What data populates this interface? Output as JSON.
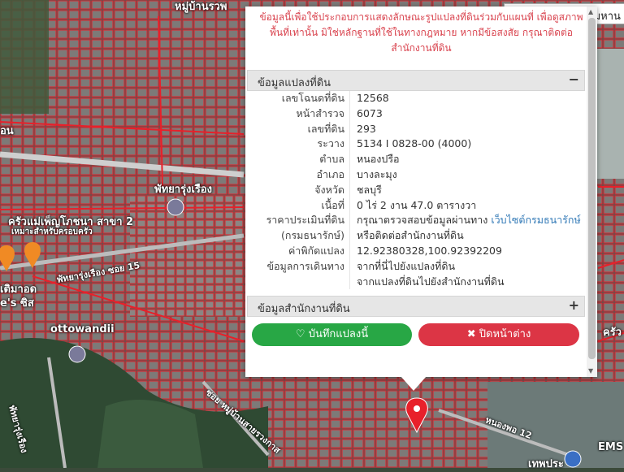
{
  "colors": {
    "parcel_line": "#e8202a",
    "save_button": "#28a745",
    "close_button": "#dc3545",
    "notice_text": "#d9434e",
    "link": "#337ab7"
  },
  "map": {
    "labels": {
      "top_center": "หมู่บ้านรวพ",
      "left_edge": "อน",
      "road_pattaya": "พัทยารุ่งเรือง",
      "restaurant": "ครัวแม่เพ็ญโภชนา สาขา 2",
      "restaurant_sub": "เหมาะสำหรับครอบครัว",
      "soi15": "พัทยารุ่งเรือง ซอย 15",
      "left_mid": "เติมาอด",
      "left_mid2": "e's ซิส",
      "ottowandii": "ottowandii",
      "road_left_vertical": "พัทยารุ่งเรือง",
      "soi_village": "ซอย หมู่บ้านสายรวงกาส",
      "nong_ponghu": "หนองพอ 12",
      "right_kitchen": "ครัว",
      "ems": "EMS",
      "thep": "เทพประ"
    }
  },
  "search": {
    "value": "เขต สาทร กรุงเทพมหาน"
  },
  "popup": {
    "notice": "ข้อมูลนี้เพื่อใช้ประกอบการแสดงลักษณะรูปแปลงที่ดินร่วมกับแผนที่ เพื่อดูสภาพพื้นที่เท่านั้น มิใช่หลักฐานที่ใช้ในทางกฎหมาย หากมีข้อสงสัย กรุณาติดต่อสำนักงานที่ดิน",
    "land_section": {
      "title": "ข้อมูลแปลงที่ดิน",
      "toggle": "−",
      "rows": [
        {
          "label": "เลขโฉนดที่ดิน",
          "value": "12568"
        },
        {
          "label": "หน้าสำรวจ",
          "value": "6073"
        },
        {
          "label": "เลขที่ดิน",
          "value": "293"
        },
        {
          "label": "ระวาง",
          "value": "5134 I 0828-00 (4000)"
        },
        {
          "label": "ตำบล",
          "value": "หนองปรือ"
        },
        {
          "label": "อำเภอ",
          "value": "บางละมุง"
        },
        {
          "label": "จังหวัด",
          "value": "ชลบุรี"
        },
        {
          "label": "เนื้อที่",
          "value": "0 ไร่ 2 งาน 47.0 ตารางวา"
        },
        {
          "label": "ราคาประเมินที่ดิน",
          "value": "กรุณาตรวจสอบข้อมูลผ่านทาง",
          "link": "เว็บไซต์กรมธนารักษ์"
        },
        {
          "label": "(กรมธนารักษ์)",
          "value": "หรือติดต่อสำนักงานที่ดิน"
        },
        {
          "label": "ค่าพิกัดแปลง",
          "link": "12.92380328,100.92392209"
        },
        {
          "label": "ข้อมูลการเดินทาง",
          "link": "จากที่นี่ไปยังแปลงที่ดิน"
        },
        {
          "label": "",
          "link": "จากแปลงที่ดินไปยังสำนักงานที่ดิน"
        }
      ]
    },
    "office_section": {
      "title": "ข้อมูลสำนักงานที่ดิน",
      "toggle": "+"
    },
    "buttons": {
      "save": "บันทึกแปลงนี้",
      "close": "ปิดหน้าต่าง"
    }
  }
}
